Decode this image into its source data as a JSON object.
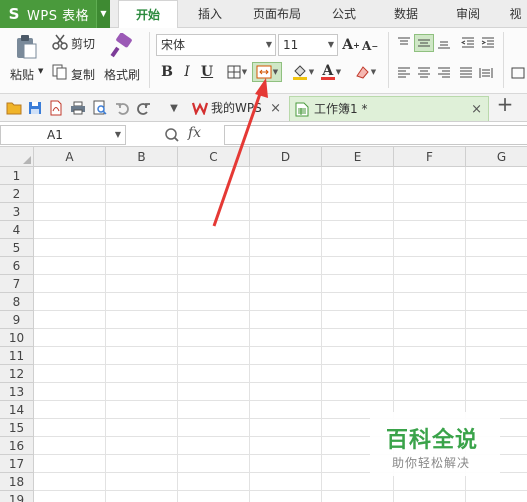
{
  "app": {
    "title": "WPS 表格",
    "logo_glyph": "S",
    "brand_color": "#4a9a3c"
  },
  "ribbon_tabs": [
    {
      "label": "开始",
      "active": true
    },
    {
      "label": "插入",
      "active": false
    },
    {
      "label": "页面布局",
      "active": false
    },
    {
      "label": "公式",
      "active": false
    },
    {
      "label": "数据",
      "active": false
    },
    {
      "label": "审阅",
      "active": false
    },
    {
      "label": "视",
      "active": false
    }
  ],
  "clipboard": {
    "paste_label": "粘贴",
    "cut_label": "剪切",
    "copy_label": "复制",
    "format_painter_label": "格式刷"
  },
  "font": {
    "name": "宋体",
    "size": "11"
  },
  "toolbar_icons": [
    "bold-icon",
    "italic-icon",
    "underline-icon",
    "borders-icon",
    "merge-cells-icon",
    "fill-color-icon",
    "font-color-icon",
    "clear-format-icon"
  ],
  "format_glyphs": {
    "bold": "B",
    "italic": "I",
    "underline": "U",
    "font_color": "A",
    "grow_font": "A",
    "shrink_font": "A",
    "grow_sup": "+",
    "shrink_sup": "−"
  },
  "quick_access_icons": [
    "open-icon",
    "save-icon",
    "export-pdf-icon",
    "print-icon",
    "print-preview-icon",
    "undo-icon",
    "redo-icon",
    "customize-icon"
  ],
  "documents": [
    {
      "label": "我的WPS",
      "close": "×"
    },
    {
      "label": "工作簿1 *",
      "close": "×"
    }
  ],
  "new_tab_label": "+",
  "formula_bar": {
    "cell_ref": "A1",
    "fx_label": "fx",
    "value": ""
  },
  "sheet": {
    "columns": [
      "A",
      "B",
      "C",
      "D",
      "E",
      "F",
      "G"
    ],
    "rows": [
      "1",
      "2",
      "3",
      "4",
      "5",
      "6",
      "7",
      "8",
      "9",
      "10",
      "11",
      "12",
      "13",
      "14",
      "15",
      "16",
      "17",
      "18",
      "19"
    ]
  },
  "watermark": {
    "title": "百科全说",
    "subtitle": "助你轻松解决"
  },
  "colors": {
    "active_tab_text": "#2b8a3e",
    "annotation_arrow": "#e53935",
    "highlight_fill": "#cfe7c6"
  }
}
